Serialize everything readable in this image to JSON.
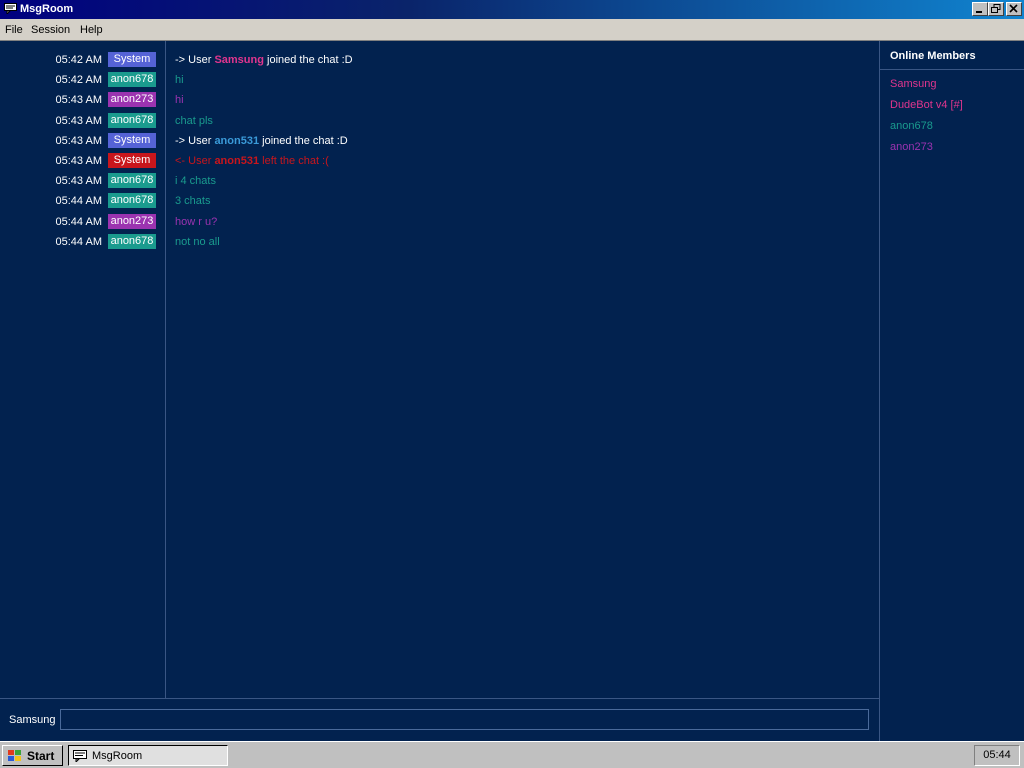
{
  "window": {
    "title": "MsgRoom"
  },
  "menu": {
    "file": "File",
    "session": "Session",
    "help": "Help"
  },
  "colors": {
    "background": "#02224f",
    "system": "#5563d6",
    "system_alert": "#c8161c",
    "anon678": "#1a9b8e",
    "anon273": "#9b33b0",
    "samsung": "#e0358e",
    "anon531": "#3a9ad8"
  },
  "messages": [
    {
      "time": "05:42 AM",
      "user": "System",
      "type": "join",
      "prefix": "-> User ",
      "name": "Samsung",
      "suffix": " joined the chat :D"
    },
    {
      "time": "05:42 AM",
      "user": "anon678",
      "type": "text",
      "text": "hi"
    },
    {
      "time": "05:43 AM",
      "user": "anon273",
      "type": "text",
      "text": "hi"
    },
    {
      "time": "05:43 AM",
      "user": "anon678",
      "type": "text",
      "text": "chat pls"
    },
    {
      "time": "05:43 AM",
      "user": "System",
      "type": "join",
      "prefix": "-> User ",
      "name": "anon531",
      "suffix": " joined the chat :D"
    },
    {
      "time": "05:43 AM",
      "user": "System",
      "type": "leave",
      "prefix": "<- User ",
      "name": "anon531",
      "suffix": " left the chat :("
    },
    {
      "time": "05:43 AM",
      "user": "anon678",
      "type": "text",
      "text": "i 4 chats"
    },
    {
      "time": "05:44 AM",
      "user": "anon678",
      "type": "text",
      "text": "3 chats"
    },
    {
      "time": "05:44 AM",
      "user": "anon273",
      "type": "text",
      "text": "how r u?"
    },
    {
      "time": "05:44 AM",
      "user": "anon678",
      "type": "text",
      "text": "not no all"
    }
  ],
  "online": {
    "title": "Online Members",
    "members": [
      {
        "name": "Samsung",
        "color": "#e0358e"
      },
      {
        "name": "DudeBot v4 [#]",
        "color": "#e0358e"
      },
      {
        "name": "anon678",
        "color": "#1a9b8e"
      },
      {
        "name": "anon273",
        "color": "#9b33b0"
      }
    ]
  },
  "input": {
    "nickname": "Samsung",
    "value": ""
  },
  "taskbar": {
    "start": "Start",
    "task": "MsgRoom",
    "clock": "05:44"
  }
}
